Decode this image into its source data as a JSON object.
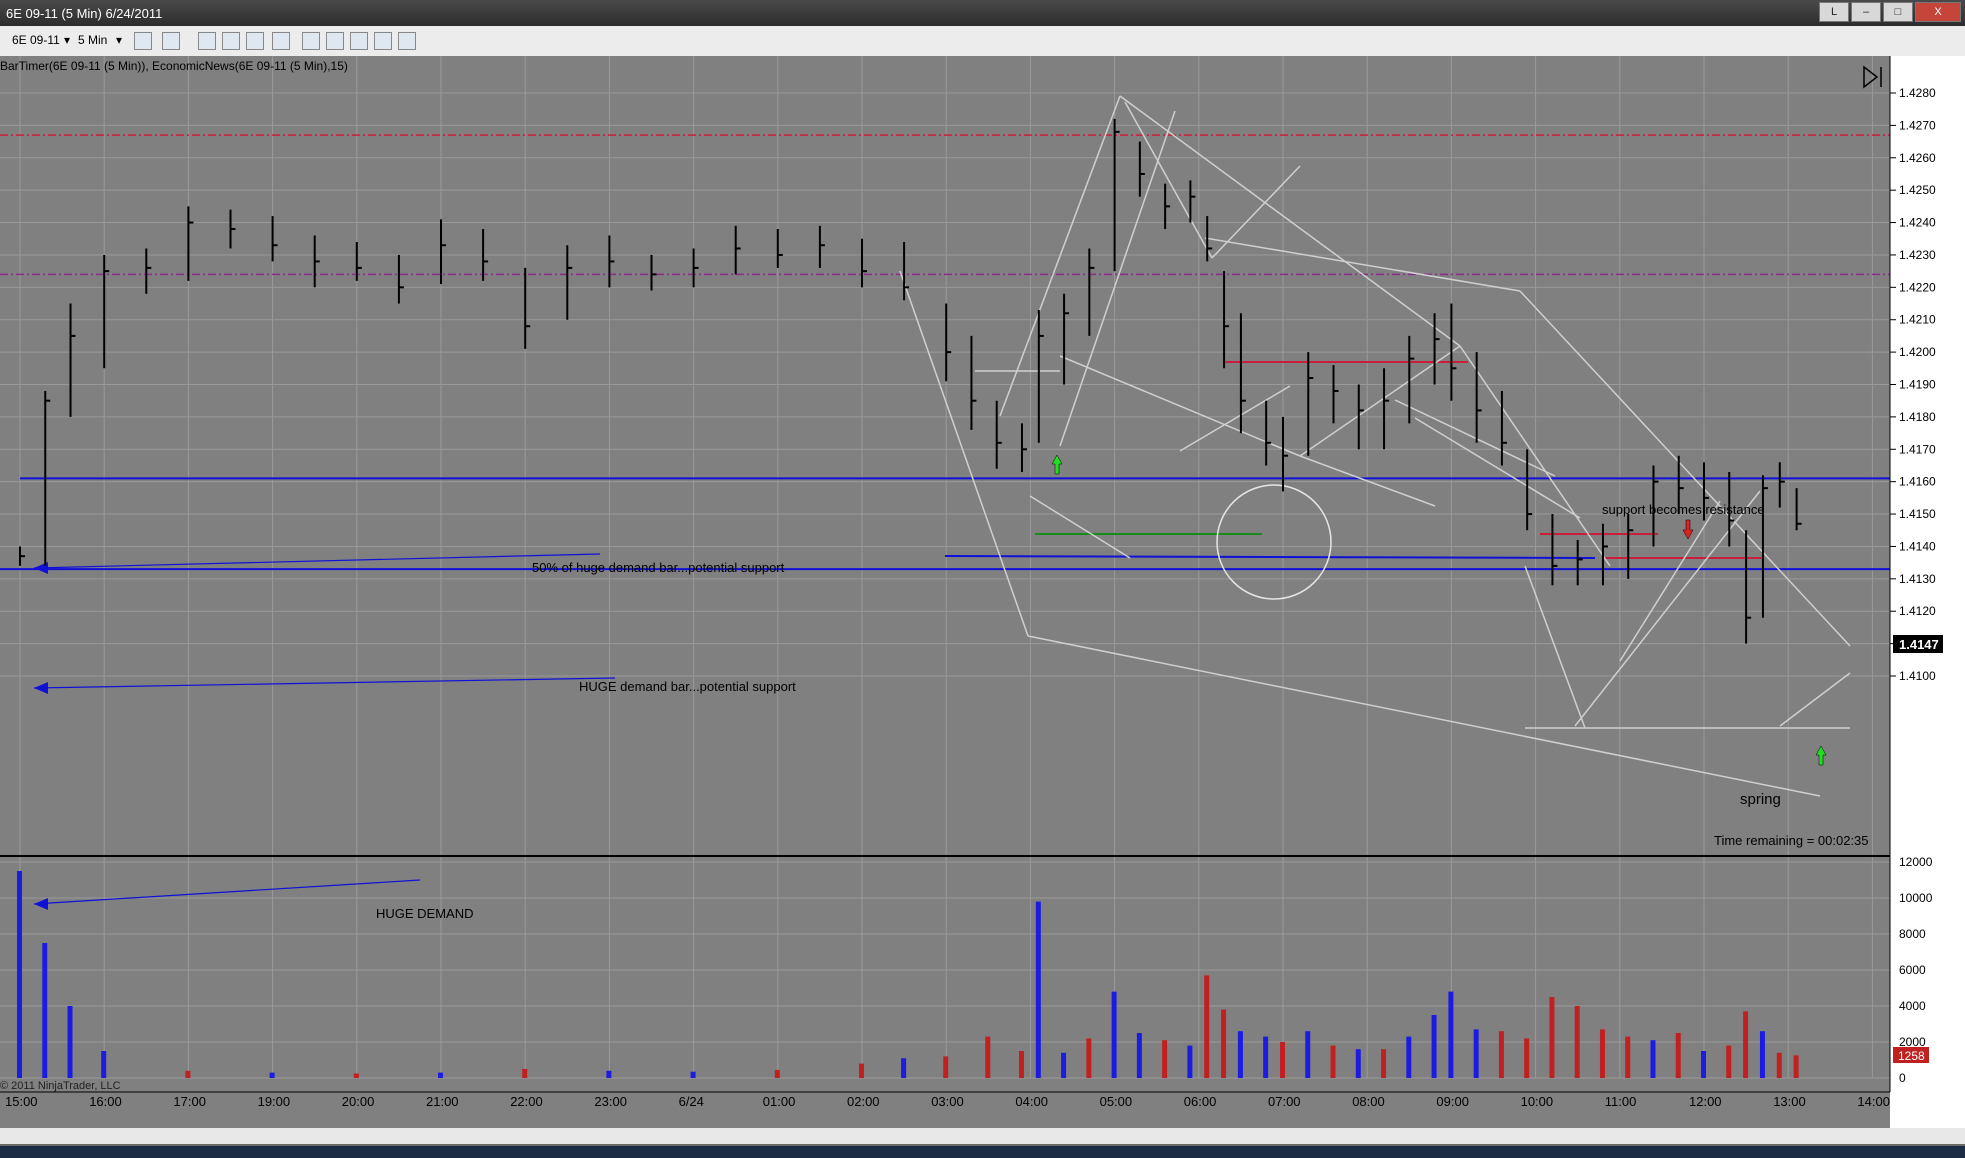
{
  "window": {
    "title": "6E 09-11 (5 Min)  6/24/2011",
    "btn_min": "–",
    "btn_max": "□",
    "btn_close": "X",
    "btn_l": "L"
  },
  "toolbar": {
    "instrument": "6E 09-11",
    "interval": "5 Min"
  },
  "chart": {
    "indicator_label": "BarTimer(6E 09-11 (5 Min)), EconomicNews(6E 09-11 (5 Min),15)",
    "copyright": "© 2011 NinjaTrader, LLC",
    "time_remaining": "Time remaining = 00:02:35",
    "last_price": "1.4147",
    "last_volume": "1258",
    "annotations": {
      "support_50": "50% of huge demand bar...potential support",
      "huge_support": "HUGE demand bar...potential support",
      "support_resistance": "support becomes resistance",
      "spring": "spring",
      "huge_demand": "HUGE DEMAND"
    },
    "colors": {
      "background": "#808080",
      "bar": "#000000",
      "up_volume": "#1c1ce0",
      "down_volume": "#c02020",
      "support_line": "#1010d8",
      "red_level": "#c81e3c",
      "purple_level": "#8a2a8a",
      "trend_line": "#cfcfcf"
    }
  },
  "chart_data": {
    "type": "bar",
    "title": "",
    "price_axis": {
      "ticks": [
        "1.4280",
        "1.4270",
        "1.4260",
        "1.4250",
        "1.4240",
        "1.4230",
        "1.4220",
        "1.4210",
        "1.4200",
        "1.4190",
        "1.4180",
        "1.4170",
        "1.4160",
        "1.4150",
        "1.4140",
        "1.4130",
        "1.4120",
        "1.4110",
        "1.4100"
      ],
      "ylim": [
        1.41,
        1.428
      ]
    },
    "volume_axis": {
      "ticks": [
        "12000",
        "10000",
        "8000",
        "6000",
        "4000",
        "2000",
        "0"
      ],
      "ylim": [
        0,
        12000
      ]
    },
    "time_axis": {
      "ticks": [
        "15:00",
        "16:00",
        "17:00",
        "19:00",
        "20:00",
        "21:00",
        "22:00",
        "23:00",
        "6/24",
        "01:00",
        "02:00",
        "03:00",
        "04:00",
        "05:00",
        "06:00",
        "07:00",
        "08:00",
        "09:00",
        "10:00",
        "11:00",
        "12:00",
        "13:00",
        "14:00"
      ]
    },
    "levels": {
      "huge_demand_support": 1.4133,
      "fifty_pct_support": 1.4161,
      "red_dashed_top": 1.4267,
      "purple_dashed": 1.4224
    },
    "price_series": [
      {
        "t": 0,
        "h": 1.414,
        "l": 1.4134,
        "c": 1.4137
      },
      {
        "t": 0.3,
        "h": 1.4188,
        "l": 1.4134,
        "c": 1.4185
      },
      {
        "t": 0.6,
        "h": 1.4215,
        "l": 1.418,
        "c": 1.4205
      },
      {
        "t": 1,
        "h": 1.423,
        "l": 1.4195,
        "c": 1.4225
      },
      {
        "t": 1.5,
        "h": 1.4232,
        "l": 1.4218,
        "c": 1.4226
      },
      {
        "t": 2,
        "h": 1.4245,
        "l": 1.4222,
        "c": 1.424
      },
      {
        "t": 2.5,
        "h": 1.4244,
        "l": 1.4232,
        "c": 1.4238
      },
      {
        "t": 3,
        "h": 1.4242,
        "l": 1.4228,
        "c": 1.4233
      },
      {
        "t": 3.5,
        "h": 1.4236,
        "l": 1.422,
        "c": 1.4228
      },
      {
        "t": 4,
        "h": 1.4234,
        "l": 1.4222,
        "c": 1.4226
      },
      {
        "t": 4.5,
        "h": 1.423,
        "l": 1.4215,
        "c": 1.422
      },
      {
        "t": 5,
        "h": 1.4241,
        "l": 1.4221,
        "c": 1.4233
      },
      {
        "t": 5.5,
        "h": 1.4238,
        "l": 1.4222,
        "c": 1.4228
      },
      {
        "t": 6,
        "h": 1.4226,
        "l": 1.4201,
        "c": 1.4208
      },
      {
        "t": 6.5,
        "h": 1.4233,
        "l": 1.421,
        "c": 1.4226
      },
      {
        "t": 7,
        "h": 1.4236,
        "l": 1.422,
        "c": 1.4228
      },
      {
        "t": 7.5,
        "h": 1.423,
        "l": 1.4219,
        "c": 1.4224
      },
      {
        "t": 8,
        "h": 1.4232,
        "l": 1.422,
        "c": 1.4226
      },
      {
        "t": 8.5,
        "h": 1.4239,
        "l": 1.4224,
        "c": 1.4232
      },
      {
        "t": 9,
        "h": 1.4238,
        "l": 1.4226,
        "c": 1.423
      },
      {
        "t": 9.5,
        "h": 1.4239,
        "l": 1.4226,
        "c": 1.4233
      },
      {
        "t": 10,
        "h": 1.4235,
        "l": 1.422,
        "c": 1.4225
      },
      {
        "t": 10.5,
        "h": 1.4234,
        "l": 1.4216,
        "c": 1.422
      },
      {
        "t": 11,
        "h": 1.4215,
        "l": 1.4191,
        "c": 1.42
      },
      {
        "t": 11.3,
        "h": 1.4205,
        "l": 1.4176,
        "c": 1.4185
      },
      {
        "t": 11.6,
        "h": 1.4185,
        "l": 1.4164,
        "c": 1.4172
      },
      {
        "t": 11.9,
        "h": 1.4178,
        "l": 1.4163,
        "c": 1.417
      },
      {
        "t": 12.1,
        "h": 1.4213,
        "l": 1.4172,
        "c": 1.4205
      },
      {
        "t": 12.4,
        "h": 1.4218,
        "l": 1.419,
        "c": 1.4212
      },
      {
        "t": 12.7,
        "h": 1.4232,
        "l": 1.4205,
        "c": 1.4226
      },
      {
        "t": 13,
        "h": 1.4272,
        "l": 1.4225,
        "c": 1.4268
      },
      {
        "t": 13.3,
        "h": 1.4265,
        "l": 1.4248,
        "c": 1.4255
      },
      {
        "t": 13.6,
        "h": 1.4252,
        "l": 1.4238,
        "c": 1.4245
      },
      {
        "t": 13.9,
        "h": 1.4253,
        "l": 1.424,
        "c": 1.4248
      },
      {
        "t": 14.1,
        "h": 1.4242,
        "l": 1.4228,
        "c": 1.4232
      },
      {
        "t": 14.3,
        "h": 1.4225,
        "l": 1.4195,
        "c": 1.4208
      },
      {
        "t": 14.5,
        "h": 1.4212,
        "l": 1.4175,
        "c": 1.4185
      },
      {
        "t": 14.8,
        "h": 1.4185,
        "l": 1.4165,
        "c": 1.4172
      },
      {
        "t": 15,
        "h": 1.418,
        "l": 1.4157,
        "c": 1.4168
      },
      {
        "t": 15.3,
        "h": 1.42,
        "l": 1.4168,
        "c": 1.4192
      },
      {
        "t": 15.6,
        "h": 1.4196,
        "l": 1.4178,
        "c": 1.4188
      },
      {
        "t": 15.9,
        "h": 1.419,
        "l": 1.417,
        "c": 1.4182
      },
      {
        "t": 16.2,
        "h": 1.4195,
        "l": 1.417,
        "c": 1.4185
      },
      {
        "t": 16.5,
        "h": 1.4205,
        "l": 1.4178,
        "c": 1.4198
      },
      {
        "t": 16.8,
        "h": 1.4212,
        "l": 1.419,
        "c": 1.4204
      },
      {
        "t": 17,
        "h": 1.4215,
        "l": 1.4185,
        "c": 1.4195
      },
      {
        "t": 17.3,
        "h": 1.42,
        "l": 1.4172,
        "c": 1.4182
      },
      {
        "t": 17.6,
        "h": 1.4188,
        "l": 1.4165,
        "c": 1.4172
      },
      {
        "t": 17.9,
        "h": 1.417,
        "l": 1.4145,
        "c": 1.415
      },
      {
        "t": 18.2,
        "h": 1.415,
        "l": 1.4128,
        "c": 1.4134
      },
      {
        "t": 18.5,
        "h": 1.4142,
        "l": 1.4128,
        "c": 1.4136
      },
      {
        "t": 18.8,
        "h": 1.4147,
        "l": 1.4128,
        "c": 1.414
      },
      {
        "t": 19.1,
        "h": 1.415,
        "l": 1.413,
        "c": 1.4145
      },
      {
        "t": 19.4,
        "h": 1.4165,
        "l": 1.414,
        "c": 1.416
      },
      {
        "t": 19.7,
        "h": 1.4168,
        "l": 1.415,
        "c": 1.4158
      },
      {
        "t": 20,
        "h": 1.4166,
        "l": 1.4148,
        "c": 1.4155
      },
      {
        "t": 20.3,
        "h": 1.4163,
        "l": 1.414,
        "c": 1.4148
      },
      {
        "t": 20.5,
        "h": 1.4145,
        "l": 1.411,
        "c": 1.4118
      },
      {
        "t": 20.7,
        "h": 1.4162,
        "l": 1.4118,
        "c": 1.4158
      },
      {
        "t": 20.9,
        "h": 1.4166,
        "l": 1.4152,
        "c": 1.416
      },
      {
        "t": 21.1,
        "h": 1.4158,
        "l": 1.4145,
        "c": 1.4147
      }
    ],
    "volume_series": [
      {
        "t": 0,
        "v": 11500,
        "d": "up"
      },
      {
        "t": 0.3,
        "v": 7500,
        "d": "up"
      },
      {
        "t": 0.6,
        "v": 4000,
        "d": "up"
      },
      {
        "t": 1,
        "v": 1500,
        "d": "up"
      },
      {
        "t": 2,
        "v": 400,
        "d": "down"
      },
      {
        "t": 3,
        "v": 300,
        "d": "up"
      },
      {
        "t": 4,
        "v": 250,
        "d": "down"
      },
      {
        "t": 5,
        "v": 300,
        "d": "up"
      },
      {
        "t": 6,
        "v": 500,
        "d": "down"
      },
      {
        "t": 7,
        "v": 400,
        "d": "up"
      },
      {
        "t": 8,
        "v": 350,
        "d": "up"
      },
      {
        "t": 9,
        "v": 450,
        "d": "down"
      },
      {
        "t": 10,
        "v": 800,
        "d": "down"
      },
      {
        "t": 10.5,
        "v": 1100,
        "d": "up"
      },
      {
        "t": 11,
        "v": 1200,
        "d": "down"
      },
      {
        "t": 11.5,
        "v": 2300,
        "d": "down"
      },
      {
        "t": 11.9,
        "v": 1500,
        "d": "down"
      },
      {
        "t": 12.1,
        "v": 9800,
        "d": "up"
      },
      {
        "t": 12.4,
        "v": 1400,
        "d": "up"
      },
      {
        "t": 12.7,
        "v": 2200,
        "d": "down"
      },
      {
        "t": 13,
        "v": 4800,
        "d": "up"
      },
      {
        "t": 13.3,
        "v": 2500,
        "d": "up"
      },
      {
        "t": 13.6,
        "v": 2100,
        "d": "down"
      },
      {
        "t": 13.9,
        "v": 1800,
        "d": "up"
      },
      {
        "t": 14.1,
        "v": 5700,
        "d": "down"
      },
      {
        "t": 14.3,
        "v": 3800,
        "d": "down"
      },
      {
        "t": 14.5,
        "v": 2600,
        "d": "up"
      },
      {
        "t": 14.8,
        "v": 2300,
        "d": "up"
      },
      {
        "t": 15,
        "v": 2000,
        "d": "down"
      },
      {
        "t": 15.3,
        "v": 2600,
        "d": "up"
      },
      {
        "t": 15.6,
        "v": 1800,
        "d": "down"
      },
      {
        "t": 15.9,
        "v": 1600,
        "d": "up"
      },
      {
        "t": 16.2,
        "v": 1600,
        "d": "down"
      },
      {
        "t": 16.5,
        "v": 2300,
        "d": "up"
      },
      {
        "t": 16.8,
        "v": 3500,
        "d": "up"
      },
      {
        "t": 17,
        "v": 4800,
        "d": "up"
      },
      {
        "t": 17.3,
        "v": 2700,
        "d": "up"
      },
      {
        "t": 17.6,
        "v": 2600,
        "d": "down"
      },
      {
        "t": 17.9,
        "v": 2200,
        "d": "down"
      },
      {
        "t": 18.2,
        "v": 4500,
        "d": "down"
      },
      {
        "t": 18.5,
        "v": 4000,
        "d": "down"
      },
      {
        "t": 18.8,
        "v": 2700,
        "d": "down"
      },
      {
        "t": 19.1,
        "v": 2300,
        "d": "down"
      },
      {
        "t": 19.4,
        "v": 2100,
        "d": "up"
      },
      {
        "t": 19.7,
        "v": 2500,
        "d": "down"
      },
      {
        "t": 20,
        "v": 1500,
        "d": "up"
      },
      {
        "t": 20.3,
        "v": 1800,
        "d": "down"
      },
      {
        "t": 20.5,
        "v": 3700,
        "d": "down"
      },
      {
        "t": 20.7,
        "v": 2600,
        "d": "up"
      },
      {
        "t": 20.9,
        "v": 1400,
        "d": "down"
      },
      {
        "t": 21.1,
        "v": 1258,
        "d": "down"
      }
    ]
  }
}
